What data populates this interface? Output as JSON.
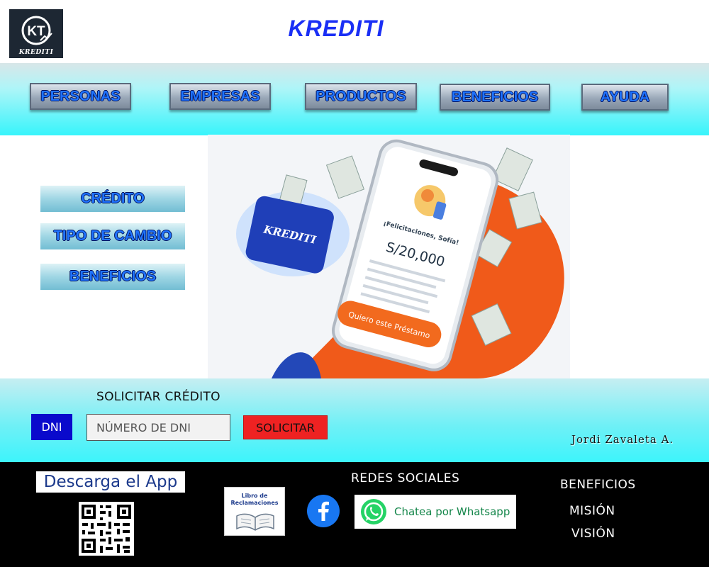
{
  "header": {
    "logo_monogram": "KT",
    "logo_text": "KREDITI",
    "brand": "KREDITI"
  },
  "nav": {
    "items": [
      {
        "label": "PERSONAS"
      },
      {
        "label": "EMPRESAS"
      },
      {
        "label": "PRODUCTOS"
      },
      {
        "label": "BENEFICIOS"
      },
      {
        "label": "AYUDA"
      }
    ]
  },
  "side_menu": {
    "items": [
      {
        "label": "CRÉDITO"
      },
      {
        "label": "TIPO DE CAMBIO"
      },
      {
        "label": "BENEFICIOS"
      }
    ]
  },
  "hero": {
    "card_brand": "KREDITI",
    "phone_greeting": "¡Felicitaciones, Sofía!",
    "phone_amount": "S/20,000",
    "phone_cta": "Quiero este Préstamo"
  },
  "form": {
    "heading": "SOLICITAR CRÉDITO",
    "dni_label": "DNI",
    "dni_placeholder": "NÚMERO DE DNI",
    "submit_label": "SOLICITAR",
    "author": "Jordi Zavaleta A."
  },
  "footer": {
    "app_title": "Descarga el App",
    "libro_line1": "Libro de",
    "libro_line2": "Reclamaciones",
    "social_title": "REDES SOCIALES",
    "whatsapp_label": "Chatea por Whatsapp",
    "links": [
      {
        "label": "BENEFICIOS"
      },
      {
        "label": "MISIÓN"
      },
      {
        "label": "VISIÓN"
      }
    ]
  },
  "colors": {
    "brand_blue": "#1a2ff5",
    "nav_text": "#1f73ff",
    "cyan_band": "#37f4fb",
    "dni_blue": "#0a0acc",
    "submit_red": "#ee2222",
    "facebook": "#1877f2",
    "whatsapp": "#25d366"
  }
}
